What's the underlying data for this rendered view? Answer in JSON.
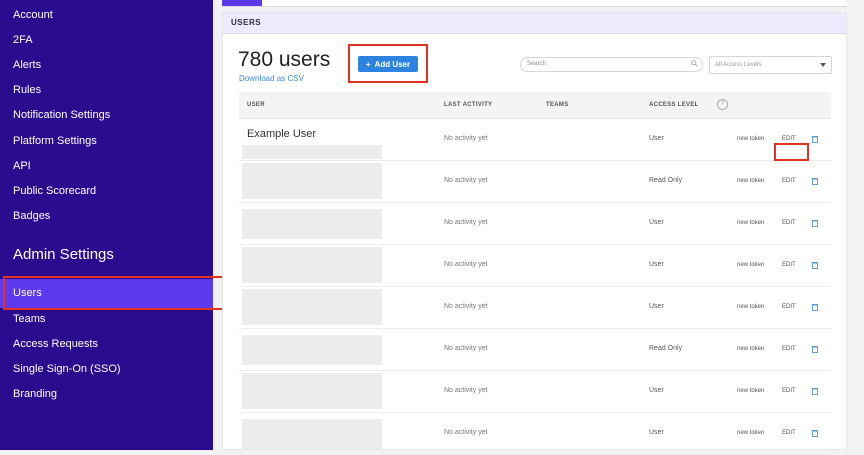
{
  "sidebar": {
    "items": [
      {
        "label": "Account"
      },
      {
        "label": "2FA"
      },
      {
        "label": "Alerts"
      },
      {
        "label": "Rules"
      },
      {
        "label": "Notification Settings"
      },
      {
        "label": "Platform Settings"
      },
      {
        "label": "API"
      },
      {
        "label": "Public Scorecard"
      },
      {
        "label": "Badges"
      }
    ],
    "admin_title": "Admin Settings",
    "admin_items": [
      {
        "label": "Users",
        "active": true
      },
      {
        "label": "Teams"
      },
      {
        "label": "Access Requests"
      },
      {
        "label": "Single Sign-On (SSO)"
      },
      {
        "label": "Branding"
      }
    ]
  },
  "main": {
    "section_title": "USERS",
    "users_count": "780 users",
    "download_link": "Download as CSV",
    "add_button": "Add User",
    "search_placeholder": "Search",
    "access_filter": "All Access Levels",
    "columns": [
      "USER",
      "LAST ACTIVITY",
      "TEAMS",
      "ACCESS LEVEL"
    ],
    "rows": [
      {
        "name": "Example User",
        "activity": "No activity yet",
        "access": "User",
        "token": "new token",
        "edit": "EDIT"
      },
      {
        "name": "",
        "activity": "No activity yet",
        "access": "Read Only",
        "token": "new token",
        "edit": "EDIT"
      },
      {
        "name": "",
        "activity": "No activity yet",
        "access": "User",
        "token": "new token",
        "edit": "EDIT"
      },
      {
        "name": "",
        "activity": "No activity yet",
        "access": "User",
        "token": "new token",
        "edit": "EDIT"
      },
      {
        "name": "",
        "activity": "No activity yet",
        "access": "User",
        "token": "new token",
        "edit": "EDIT"
      },
      {
        "name": "",
        "activity": "No activity yet",
        "access": "Read Only",
        "token": "new token",
        "edit": "EDIT"
      },
      {
        "name": "",
        "activity": "No activity yet",
        "access": "User",
        "token": "new token",
        "edit": "EDIT"
      },
      {
        "name": "",
        "activity": "No activity yet",
        "access": "User",
        "token": "new token",
        "edit": "EDIT"
      }
    ]
  },
  "colors": {
    "sidebar_bg": "#2b0c8f",
    "active_item": "#5d3af0",
    "primary_button": "#2d84e0",
    "highlight": "#e0321c"
  }
}
